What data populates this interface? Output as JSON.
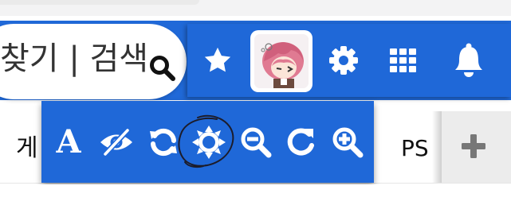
{
  "search": {
    "text": "찾기 | 검색",
    "icon": "search-icon"
  },
  "toolbar": {
    "background": "#1f68d8",
    "items": [
      {
        "name": "star-icon"
      },
      {
        "name": "avatar"
      },
      {
        "name": "gear-icon"
      },
      {
        "name": "grid-icon"
      },
      {
        "name": "bell-icon"
      }
    ]
  },
  "tabs": {
    "left_label": "게",
    "right_label": "PS",
    "add_icon": "plus-icon"
  },
  "popup": {
    "font_glyph": "A",
    "items": [
      {
        "name": "font-icon"
      },
      {
        "name": "eye-slash-icon"
      },
      {
        "name": "sync-icon"
      },
      {
        "name": "brightness-icon"
      },
      {
        "name": "zoom-out-icon"
      },
      {
        "name": "refresh-icon"
      },
      {
        "name": "zoom-in-icon"
      }
    ]
  },
  "colors": {
    "accent": "#2069d8",
    "icon": "#ffffff",
    "text": "#111111"
  }
}
